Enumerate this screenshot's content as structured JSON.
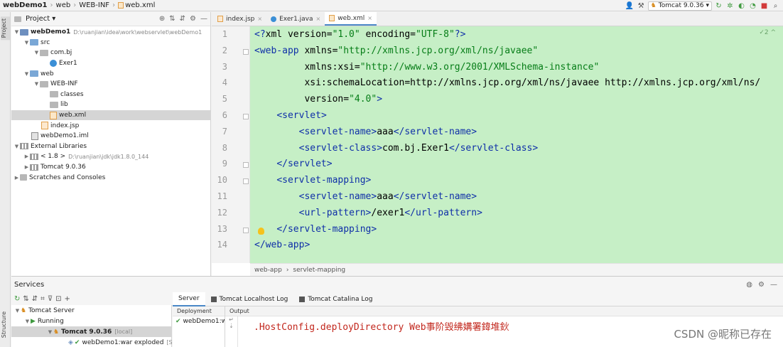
{
  "breadcrumb": [
    "webDemo1",
    "web",
    "WEB-INF",
    "web.xml"
  ],
  "run_config": "Tomcat 9.0.36",
  "stripe_tabs": {
    "project": "Project",
    "structure": "Structure"
  },
  "project_panel": {
    "title": "Project",
    "tree": [
      {
        "label": "webDemo1",
        "path": "D:\\ruanjian\\idea\\work\\webservlet\\webDemo1",
        "icon": "module-folder-icon",
        "bold": true
      },
      {
        "label": "src",
        "icon": "source-folder-icon"
      },
      {
        "label": "com.bj",
        "icon": "package-icon"
      },
      {
        "label": "Exer1",
        "icon": "class-icon"
      },
      {
        "label": "web",
        "icon": "web-folder-icon"
      },
      {
        "label": "WEB-INF",
        "icon": "folder-icon"
      },
      {
        "label": "classes",
        "icon": "folder-icon"
      },
      {
        "label": "lib",
        "icon": "folder-icon"
      },
      {
        "label": "web.xml",
        "icon": "xml-file-icon",
        "selected": true
      },
      {
        "label": "index.jsp",
        "icon": "jsp-file-icon"
      },
      {
        "label": "webDemo1.iml",
        "icon": "iml-file-icon"
      },
      {
        "label": "External Libraries",
        "icon": "library-icon"
      },
      {
        "label": "< 1.8 >",
        "path": "D:\\ruanjian\\jdk\\jdk1.8.0_144",
        "icon": "jdk-icon"
      },
      {
        "label": "Tomcat 9.0.36",
        "icon": "library-icon"
      },
      {
        "label": "Scratches and Consoles",
        "icon": "scratches-icon"
      }
    ]
  },
  "editor": {
    "tabs": [
      {
        "label": "index.jsp",
        "active": false
      },
      {
        "label": "Exer1.java",
        "active": false
      },
      {
        "label": "web.xml",
        "active": true
      }
    ],
    "corner_indicator": "✓2 ^",
    "line_numbers": [
      "1",
      "2",
      "3",
      "4",
      "5",
      "6",
      "7",
      "8",
      "9",
      "10",
      "11",
      "12",
      "13",
      "14"
    ],
    "lines": [
      "<?xml version=\"1.0\" encoding=\"UTF-8\"?>",
      "<web-app xmlns=\"http://xmlns.jcp.org/xml/ns/javaee\"",
      "         xmlns:xsi=\"http://www.w3.org/2001/XMLSchema-instance\"",
      "         xsi:schemaLocation=\"http://xmlns.jcp.org/xml/ns/javaee http://xmlns.jcp.org/xml/ns/",
      "         version=\"4.0\">",
      "    <servlet>",
      "        <servlet-name>aaa</servlet-name>",
      "        <servlet-class>com.bj.Exer1</servlet-class>",
      "    </servlet>",
      "    <servlet-mapping>",
      "        <servlet-name>aaa</servlet-name>",
      "        <url-pattern>/exer1</url-pattern>",
      "    </servlet-mapping>",
      "</web-app>"
    ],
    "breadcrumb": [
      "web-app",
      "servlet-mapping"
    ]
  },
  "services": {
    "title": "Services",
    "tree": [
      {
        "label": "Tomcat Server"
      },
      {
        "label": "Running"
      },
      {
        "label": "Tomcat 9.0.36",
        "suffix": "[local]",
        "selected": true
      },
      {
        "label": "webDemo1:war exploded",
        "suffix": "[S"
      }
    ],
    "tabs": [
      "Server",
      "Tomcat Localhost Log",
      "Tomcat Catalina Log"
    ],
    "deployment_header": "Deployment",
    "output_header": "Output",
    "deployment_item": "webDemo1:w",
    "output_line": ".HostConfig.deployDirectory Web事阶毁绋媾署鍏堆鈥"
  },
  "watermark": "CSDN @昵称已存在",
  "colors": {
    "accent": "#4a88c7",
    "editor_bg": "#c6efc6",
    "tag": "#0f2fa8",
    "string": "#067d17"
  }
}
